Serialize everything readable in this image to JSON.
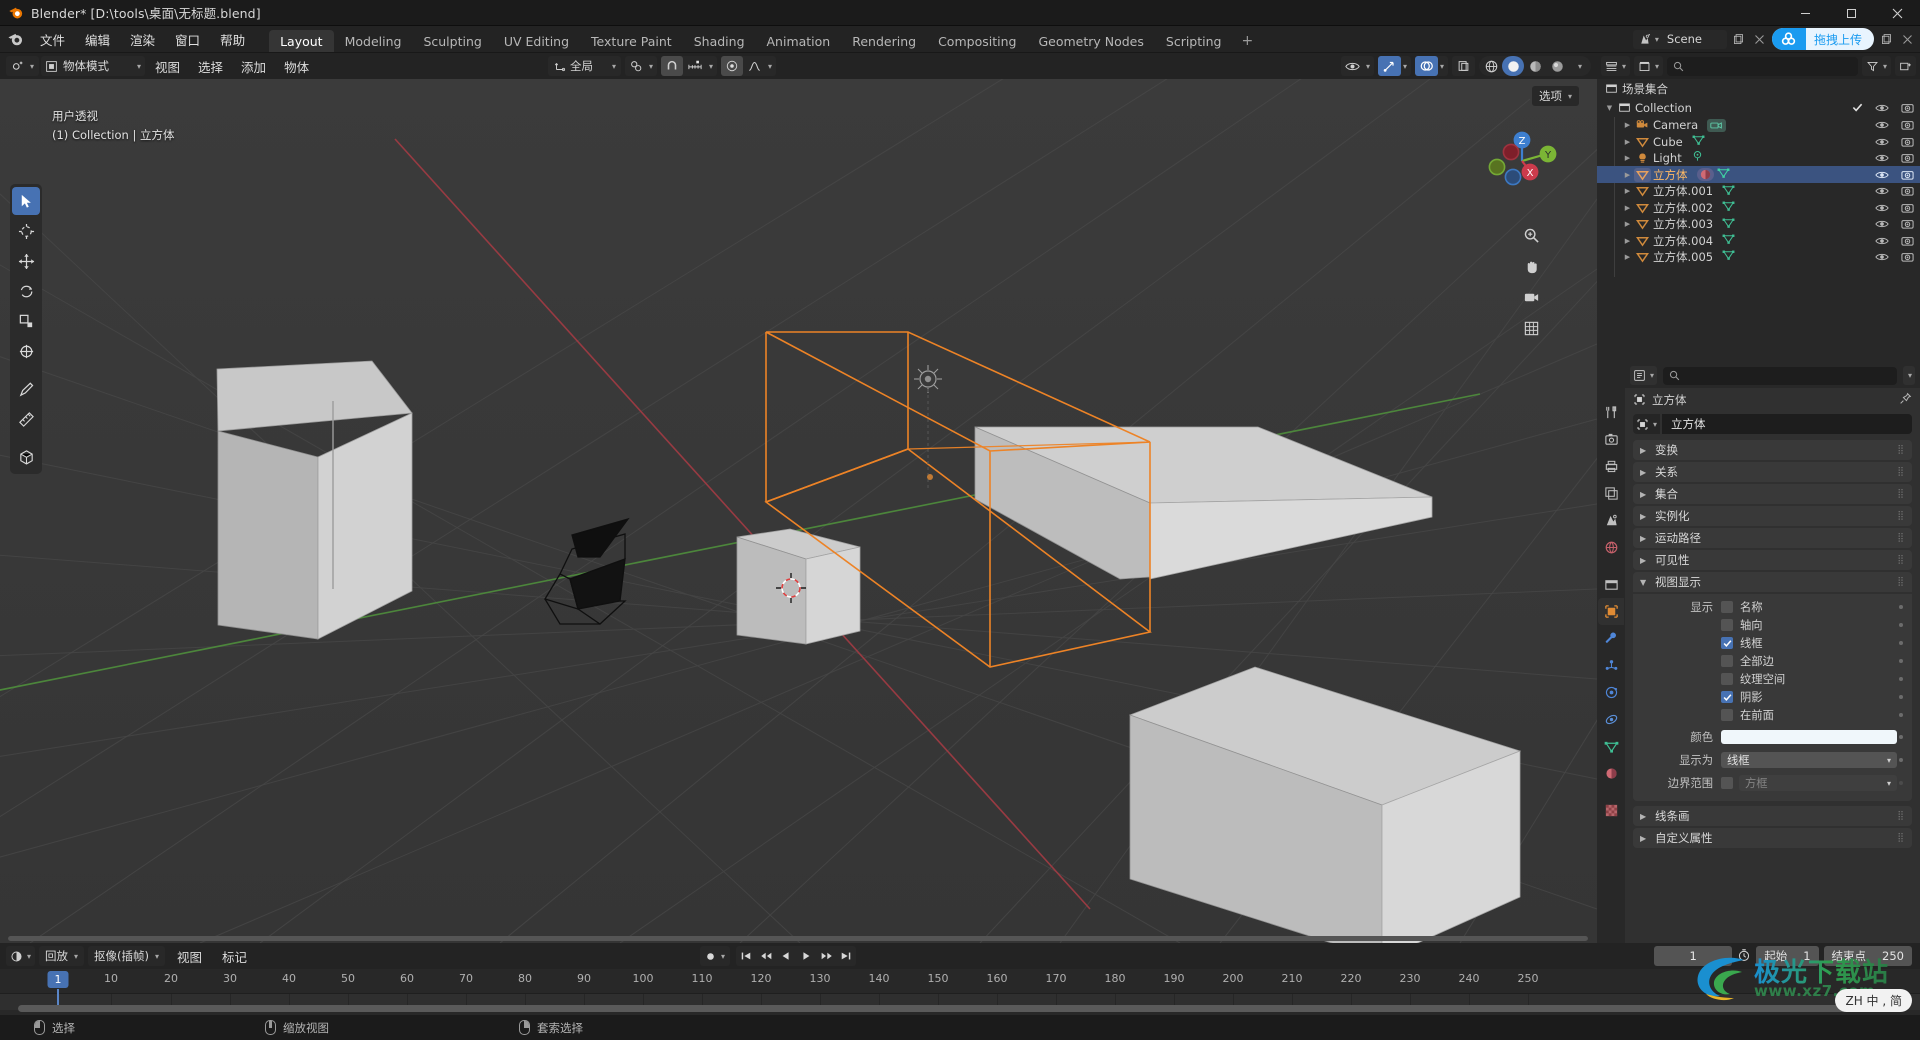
{
  "window": {
    "title": "Blender* [D:\\tools\\桌面\\无标题.blend]",
    "min_label": "–",
    "max_label": "□",
    "close_label": "✕"
  },
  "topbar": {
    "menus": [
      "文件",
      "编辑",
      "渲染",
      "窗口",
      "帮助"
    ],
    "workspaces": [
      {
        "label": "Layout",
        "active": true
      },
      {
        "label": "Modeling",
        "active": false
      },
      {
        "label": "Sculpting",
        "active": false
      },
      {
        "label": "UV Editing",
        "active": false
      },
      {
        "label": "Texture Paint",
        "active": false
      },
      {
        "label": "Shading",
        "active": false
      },
      {
        "label": "Animation",
        "active": false
      },
      {
        "label": "Rendering",
        "active": false
      },
      {
        "label": "Compositing",
        "active": false
      },
      {
        "label": "Geometry Nodes",
        "active": false
      },
      {
        "label": "Scripting",
        "active": false
      }
    ],
    "add_workspace": "+",
    "scene_name": "Scene",
    "upload_button": "拖拽上传"
  },
  "viewport": {
    "mode": "物体模式",
    "menus": [
      "视图",
      "选择",
      "添加",
      "物体"
    ],
    "transform_orientation": "全局",
    "options_label": "选项",
    "overlay_line1": "用户透视",
    "overlay_line2": "(1) Collection | 立方体",
    "gizmo_axes": {
      "x": "X",
      "y": "Y",
      "z": "Z"
    }
  },
  "outliner": {
    "search_placeholder": "",
    "root": "场景集合",
    "rows": [
      {
        "name": "Collection",
        "icon": "collection-icon",
        "level": 0,
        "selected": false,
        "has_checkbox": true,
        "data_icons": []
      },
      {
        "name": "Camera",
        "icon": "camera-object-icon",
        "level": 1,
        "selected": false,
        "has_checkbox": false,
        "data_icons": [
          "camera-data-icon"
        ]
      },
      {
        "name": "Cube",
        "icon": "mesh-object-icon",
        "level": 1,
        "selected": false,
        "has_checkbox": false,
        "data_icons": [
          "mesh-data-icon"
        ]
      },
      {
        "name": "Light",
        "icon": "light-object-icon",
        "level": 1,
        "selected": false,
        "has_checkbox": false,
        "data_icons": [
          "light-data-icon"
        ]
      },
      {
        "name": "立方体",
        "icon": "mesh-object-icon",
        "level": 1,
        "selected": true,
        "has_checkbox": false,
        "data_icons": [
          "material-data-icon",
          "mesh-data-icon"
        ]
      },
      {
        "name": "立方体.001",
        "icon": "mesh-object-icon",
        "level": 1,
        "selected": false,
        "has_checkbox": false,
        "data_icons": [
          "mesh-data-icon"
        ]
      },
      {
        "name": "立方体.002",
        "icon": "mesh-object-icon",
        "level": 1,
        "selected": false,
        "has_checkbox": false,
        "data_icons": [
          "mesh-data-icon"
        ]
      },
      {
        "name": "立方体.003",
        "icon": "mesh-object-icon",
        "level": 1,
        "selected": false,
        "has_checkbox": false,
        "data_icons": [
          "mesh-data-icon"
        ]
      },
      {
        "name": "立方体.004",
        "icon": "mesh-object-icon",
        "level": 1,
        "selected": false,
        "has_checkbox": false,
        "data_icons": [
          "mesh-data-icon"
        ]
      },
      {
        "name": "立方体.005",
        "icon": "mesh-object-icon",
        "level": 1,
        "selected": false,
        "has_checkbox": false,
        "data_icons": [
          "mesh-data-icon"
        ]
      }
    ]
  },
  "properties": {
    "breadcrumb_object": "立方体",
    "id_name": "立方体",
    "panels": [
      {
        "label": "变换",
        "open": false
      },
      {
        "label": "关系",
        "open": false
      },
      {
        "label": "集合",
        "open": false
      },
      {
        "label": "实例化",
        "open": false
      },
      {
        "label": "运动路径",
        "open": false
      },
      {
        "label": "可见性",
        "open": false
      },
      {
        "label": "视图显示",
        "open": true
      }
    ],
    "viewport_display": {
      "show_label": "显示",
      "checkboxes": [
        {
          "label": "名称",
          "checked": false
        },
        {
          "label": "轴向",
          "checked": false
        },
        {
          "label": "线框",
          "checked": true
        },
        {
          "label": "全部边",
          "checked": false
        },
        {
          "label": "纹理空间",
          "checked": false
        },
        {
          "label": "阴影",
          "checked": true
        },
        {
          "label": "在前面",
          "checked": false
        }
      ],
      "color_label": "颜色",
      "color_value": "#f0f7fb",
      "display_as_label": "显示为",
      "display_as_value": "线框",
      "bounds_label": "边界范围",
      "bounds_checked": false,
      "bounds_value": "方框"
    },
    "trailing_panels": [
      {
        "label": "线条画",
        "open": false
      },
      {
        "label": "自定义属性",
        "open": false
      }
    ]
  },
  "timeline": {
    "playback_menu": "回放",
    "keying_menu": "抠像(插帧)",
    "menus": [
      "视图",
      "标记"
    ],
    "current_frame": "1",
    "start_label": "起始",
    "start_value": "1",
    "end_label": "结束点",
    "end_value": "250",
    "ticks": [
      "10",
      "20",
      "30",
      "40",
      "50",
      "60",
      "70",
      "80",
      "90",
      "100",
      "110",
      "120",
      "130",
      "140",
      "150",
      "160",
      "170",
      "180",
      "190",
      "200",
      "210",
      "220",
      "230",
      "240",
      "250"
    ],
    "playhead_frame": "1"
  },
  "statusbar": {
    "items": [
      {
        "mouse": "left",
        "label": "选择"
      },
      {
        "mouse": "middle",
        "label": "缩放视图"
      },
      {
        "mouse": "right",
        "label": "套索选择"
      }
    ]
  },
  "watermark": {
    "title": "极光下载站",
    "url": "www.xz7.com",
    "badge": "ZH 中 , 简"
  },
  "colors": {
    "accent_blue": "#4772b3",
    "selected_orange": "#ffb964",
    "viewport_bg": "#393939",
    "panel_bg": "#303030",
    "header_bg": "#232323"
  }
}
